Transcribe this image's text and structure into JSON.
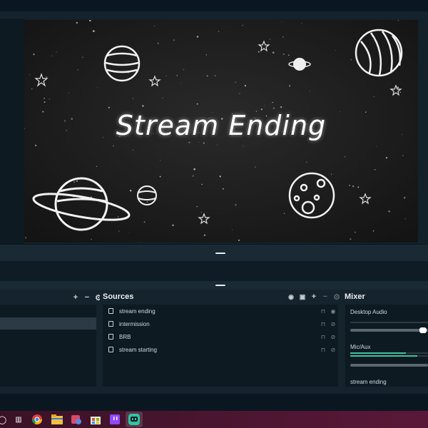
{
  "preview": {
    "scene_title": "Stream Ending"
  },
  "docks": {
    "scenes": {
      "rows": [
        {
          "selected": true
        }
      ]
    },
    "sources": {
      "title": "Sources",
      "items": [
        {
          "label": "stream ending",
          "visible": true
        },
        {
          "label": "intermission",
          "visible": false
        },
        {
          "label": "BRB",
          "visible": false
        },
        {
          "label": "stream starting",
          "visible": false
        }
      ]
    },
    "mixer": {
      "title": "Mixer",
      "channels": [
        {
          "label": "Desktop Audio",
          "meter_level": 0,
          "volume": 1.0
        },
        {
          "label": "Mic/Aux",
          "meter_level": 0.75,
          "volume": 0.9
        },
        {
          "label": "stream ending"
        }
      ]
    }
  },
  "taskbar": {
    "icons": [
      "windows-icon",
      "task-view-icon",
      "chrome-icon",
      "file-explorer-icon",
      "app-icon",
      "store-icon",
      "twitch-icon",
      "streamlabs-icon"
    ],
    "accent": "#4a1530"
  },
  "colors": {
    "background": "#0f1c25",
    "panel": "#15232d",
    "meter_green": "#3ec29a"
  }
}
